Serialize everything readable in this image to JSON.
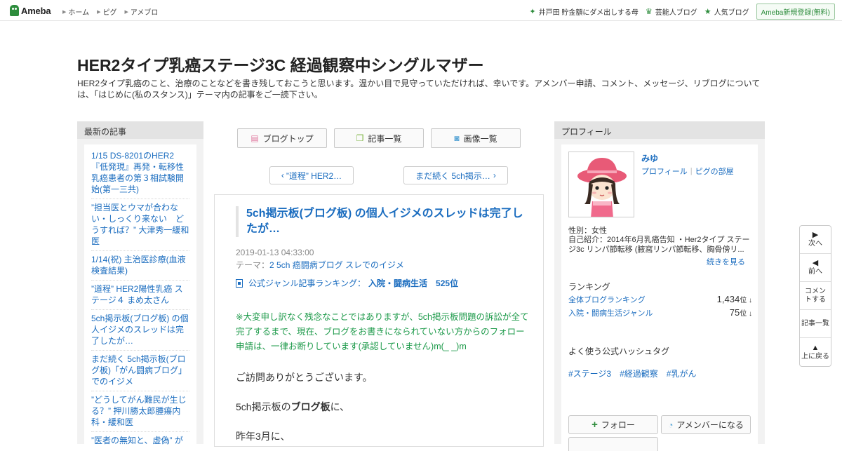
{
  "header": {
    "logo_text": "Ameba",
    "nav": [
      "ホーム",
      "ピグ",
      "アメブロ"
    ],
    "right_links": [
      {
        "icon": "sparkle-icon",
        "label": "井戸田 貯金額にダメ出しする母"
      },
      {
        "icon": "crown-icon",
        "label": "芸能人ブログ"
      },
      {
        "icon": "star-icon",
        "label": "人気ブログ"
      }
    ],
    "register_label": "Ameba新規登録(無料)"
  },
  "blog": {
    "title": "HER2タイプ乳癌ステージ3C 経過観察中シングルマザー",
    "description": "HER2タイプ乳癌のこと、治療のことなどを書き残しておこうと思います。温かい目で見守っていただければ、幸いです。アメンバー申請、コメント、メッセージ、リブログについては、「はじめに(私のスタンス)」テーマ内の記事をご一読下さい。"
  },
  "left_sidebar": {
    "heading": "最新の記事",
    "items": [
      "1/15 DS-8201のHER2『低発現』再発・転移性乳癌患者の第３相試験開始(第一三共)",
      "”担当医とウマが合わない・しっくり来ない　どうすれば？” 大津秀一緩和医",
      "1/14(祝) 主治医診療(血液検査結果)",
      "”道程” HER2陽性乳癌 ステージ４ まめ太さん",
      "5ch掲示板(ブログ板) の個人イジメのスレッドは完了したが…",
      "まだ続く 5ch掲示板(ブログ板)「がん闘病ブログ」でのイジメ",
      "”どうしてがん難民が生じる？” 押川勝太郎腫瘍内科・緩和医",
      "”医者の無知と、虚偽” がん カテーテル治療 関明彦"
    ]
  },
  "center": {
    "nav_buttons": [
      {
        "icon": "document-icon",
        "label": "ブログトップ"
      },
      {
        "icon": "list-icon",
        "label": "記事一覧"
      },
      {
        "icon": "camera-icon",
        "label": "画像一覧"
      }
    ],
    "prev_label": "”道程” HER2…",
    "next_label": "まだ続く 5ch掲示…",
    "article": {
      "title": "5ch掲示板(ブログ板) の個人イジメのスレッドは完了したが…",
      "date": "2019-01-13 04:33:00",
      "theme_prefix": "テーマ：",
      "theme": "2 5ch 癌闘病ブログ スレでのイジメ",
      "ranking_prefix": "公式ジャンル記事ランキング：",
      "ranking_text": "入院・闘病生活　525位",
      "notice": "※大変申し訳なく残念なことではありますが、5ch掲示板問題の訴訟が全て完了するまで、現在、ブログをお書きになられていない方からのフォロー申請は、一律お断りしています(承認していません)m(_ _)m",
      "p1": "ご訪問ありがとうございます。",
      "p2_pre": "5ch掲示板の",
      "p2_bold": "ブログ板",
      "p2_post": "に、",
      "p3": "昨年3月に、"
    }
  },
  "right_sidebar": {
    "heading": "プロフィール",
    "name": "みゆ",
    "profile_link": "プロフィール",
    "pig_link": "ピグの部屋",
    "gender": "性別：女性",
    "intro": "自己紹介：2014年6月乳癌告知 ・Her2タイプ ステージ3c リンパ節転移 (腋窩リンパ節転移、胸骨傍リ...",
    "more": "続きを見る",
    "ranking_heading": "ランキング",
    "rankings": [
      {
        "label": "全体ブログランキング",
        "value": "1,434",
        "unit": "位 ↓"
      },
      {
        "label": "入院・闘病生活ジャンル",
        "value": "75",
        "unit": "位 ↓"
      }
    ],
    "hashtag_heading": "よく使う公式ハッシュタグ",
    "hashtags": [
      "#ステージ3",
      "#経過観察",
      "#乳がん"
    ],
    "follow_label": "フォロー",
    "member_label": "アメンバーになる"
  },
  "float_nav": {
    "next": "次へ",
    "prev": "前へ",
    "comment": "コメントする",
    "list": "記事一覧",
    "top": "上に戻る"
  },
  "colors": {
    "link": "#1a6cbf",
    "brand_green": "#2d8c3c",
    "notice_green": "#1d9a4a"
  }
}
